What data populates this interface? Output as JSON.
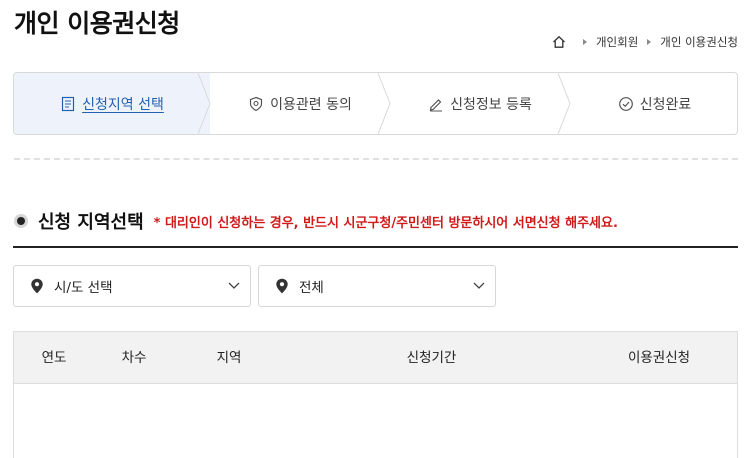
{
  "page": {
    "title": "개인 이용권신청"
  },
  "breadcrumb": {
    "items": [
      "개인회원",
      "개인 이용권신청"
    ]
  },
  "steps": [
    {
      "label": "신청지역 선택",
      "icon": "document-icon",
      "active": true
    },
    {
      "label": "이용관련 동의",
      "icon": "shield-icon",
      "active": false
    },
    {
      "label": "신청정보 등록",
      "icon": "pencil-icon",
      "active": false
    },
    {
      "label": "신청완료",
      "icon": "check-circle-icon",
      "active": false
    }
  ],
  "section": {
    "title": "신청 지역선택",
    "notice": "* 대리인이 신청하는 경우, 반드시 시군구청/주민센터 방문하시어 서면신청 해주세요."
  },
  "filters": {
    "province": {
      "value": "시/도 선택",
      "icon": "location-pin-icon"
    },
    "district": {
      "value": "전체",
      "icon": "location-pin-icon"
    }
  },
  "table": {
    "columns": [
      "연도",
      "차수",
      "지역",
      "신청기간",
      "이용권신청"
    ],
    "rows": []
  },
  "colors": {
    "active_step_bg": "#eef3fb",
    "active_step_text": "#2260b3",
    "notice_red": "#d11a1a"
  }
}
